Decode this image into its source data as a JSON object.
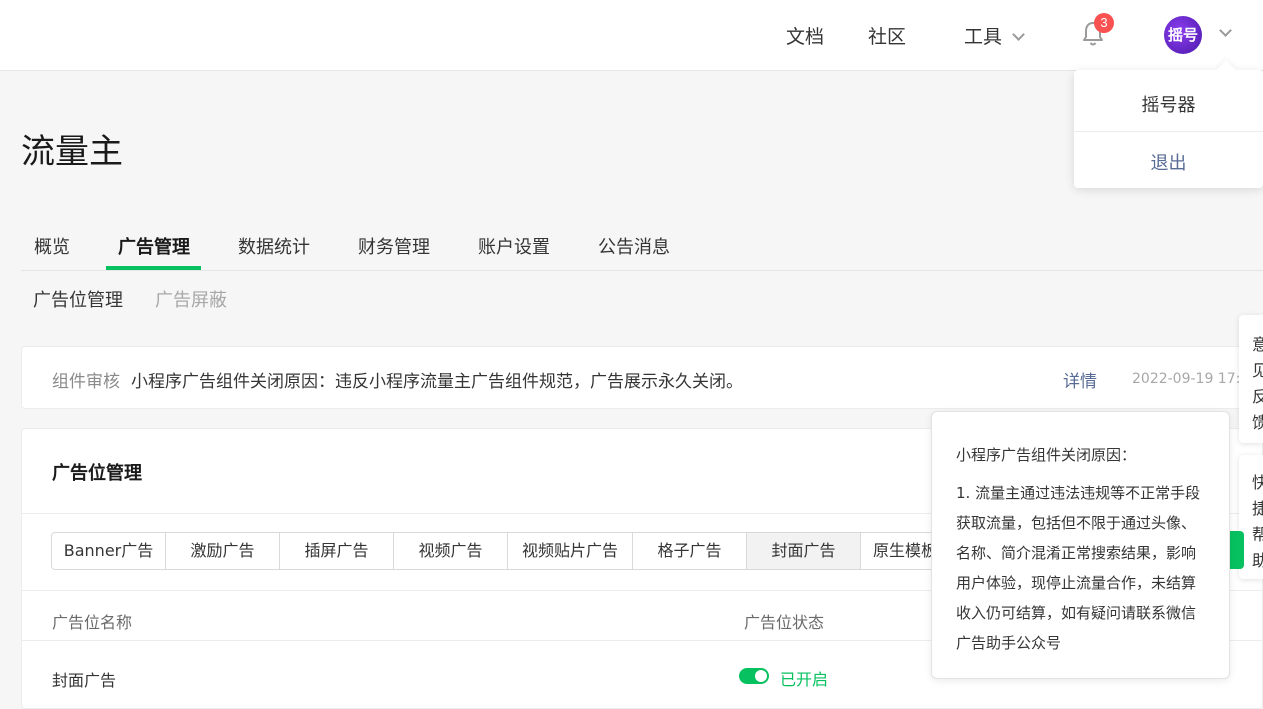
{
  "header": {
    "nav": {
      "docs": "文档",
      "community": "社区",
      "tools": "工具"
    },
    "notification_count": "3",
    "avatar_text": "摇号"
  },
  "user_menu": {
    "account_name": "摇号器",
    "logout": "退出"
  },
  "page_title": "流量主",
  "tabs": [
    "概览",
    "广告管理",
    "数据统计",
    "财务管理",
    "账户设置",
    "公告消息"
  ],
  "active_tab": "广告管理",
  "subtabs": [
    "广告位管理",
    "广告屏蔽"
  ],
  "notice": {
    "label": "组件审核",
    "message": "小程序广告组件关闭原因：违反小程序流量主广告组件规范，广告展示永久关闭。",
    "detail_link": "详情",
    "date": "2022-09-19 17:"
  },
  "ad_panel": {
    "title": "广告位管理",
    "ad_types": [
      "Banner广告",
      "激励广告",
      "插屏广告",
      "视频广告",
      "视频贴片广告",
      "格子广告",
      "封面广告",
      "原生模板"
    ],
    "selected_type": "封面广告",
    "columns": {
      "name": "广告位名称",
      "status": "广告位状态"
    },
    "rows": [
      {
        "name": "封面广告",
        "status": "已开启"
      }
    ]
  },
  "tooltip": {
    "title": "小程序广告组件关闭原因：",
    "body": "1. 流量主通过违法违规等不正常手段获取流量，包括但不限于通过头像、名称、简介混淆正常搜索结果，影响用户体验，现停止流量合作，未结算收入仍可结算，如有疑问请联系微信广告助手公众号"
  },
  "side_cards": {
    "feedback": "意见反馈",
    "help": "快捷帮助"
  },
  "colors": {
    "accent": "#07c160",
    "link": "#576b95",
    "badge": "#fa5151"
  }
}
